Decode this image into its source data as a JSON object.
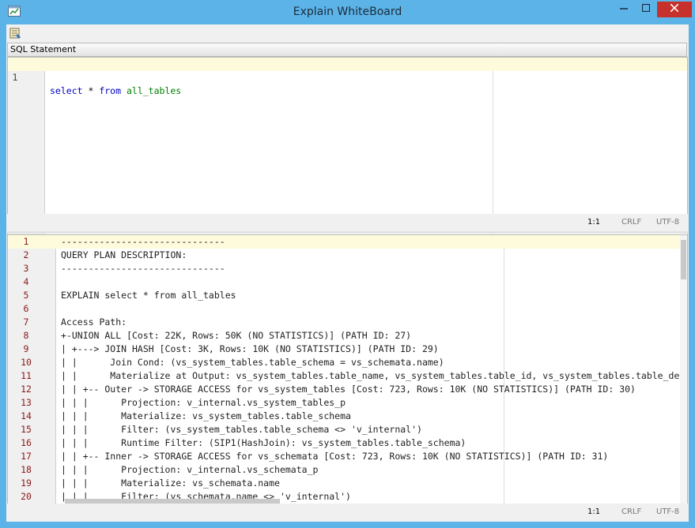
{
  "window": {
    "title": "Explain WhiteBoard",
    "app_icon": "whiteboard-icon"
  },
  "toolbar": {
    "run_icon": "explain-run-icon"
  },
  "sql_panel": {
    "header": "SQL Statement",
    "lines": [
      {
        "num": "1",
        "kw1": "select",
        "op": " * ",
        "kw2": "from",
        "space": " ",
        "ident": "all_tables"
      }
    ],
    "status": {
      "position": "1:1",
      "eol": "CRLF",
      "encoding": "UTF-8"
    }
  },
  "plan_panel": {
    "lines": [
      {
        "num": "1",
        "text": "------------------------------"
      },
      {
        "num": "2",
        "text": "QUERY PLAN DESCRIPTION:"
      },
      {
        "num": "3",
        "text": "------------------------------"
      },
      {
        "num": "4",
        "text": ""
      },
      {
        "num": "5",
        "text": "EXPLAIN select * from all_tables"
      },
      {
        "num": "6",
        "text": ""
      },
      {
        "num": "7",
        "text": "Access Path:"
      },
      {
        "num": "8",
        "text": "+-UNION ALL [Cost: 22K, Rows: 50K (NO STATISTICS)] (PATH ID: 27)"
      },
      {
        "num": "9",
        "text": "| +---> JOIN HASH [Cost: 3K, Rows: 10K (NO STATISTICS)] (PATH ID: 29)"
      },
      {
        "num": "10",
        "text": "| |      Join Cond: (vs_system_tables.table_schema = vs_schemata.name)"
      },
      {
        "num": "11",
        "text": "| |      Materialize at Output: vs_system_tables.table_name, vs_system_tables.table_id, vs_system_tables.table_des"
      },
      {
        "num": "12",
        "text": "| | +-- Outer -> STORAGE ACCESS for vs_system_tables [Cost: 723, Rows: 10K (NO STATISTICS)] (PATH ID: 30)"
      },
      {
        "num": "13",
        "text": "| | |      Projection: v_internal.vs_system_tables_p"
      },
      {
        "num": "14",
        "text": "| | |      Materialize: vs_system_tables.table_schema"
      },
      {
        "num": "15",
        "text": "| | |      Filter: (vs_system_tables.table_schema <> 'v_internal')"
      },
      {
        "num": "16",
        "text": "| | |      Runtime Filter: (SIP1(HashJoin): vs_system_tables.table_schema)"
      },
      {
        "num": "17",
        "text": "| | +-- Inner -> STORAGE ACCESS for vs_schemata [Cost: 723, Rows: 10K (NO STATISTICS)] (PATH ID: 31)"
      },
      {
        "num": "18",
        "text": "| | |      Projection: v_internal.vs_schemata_p"
      },
      {
        "num": "19",
        "text": "| | |      Materialize: vs_schemata.name"
      },
      {
        "num": "20",
        "text": "| | |      Filter: (vs_schemata.name <> 'v_internal')"
      }
    ],
    "status": {
      "position": "1:1",
      "eol": "CRLF",
      "encoding": "UTF-8"
    }
  }
}
